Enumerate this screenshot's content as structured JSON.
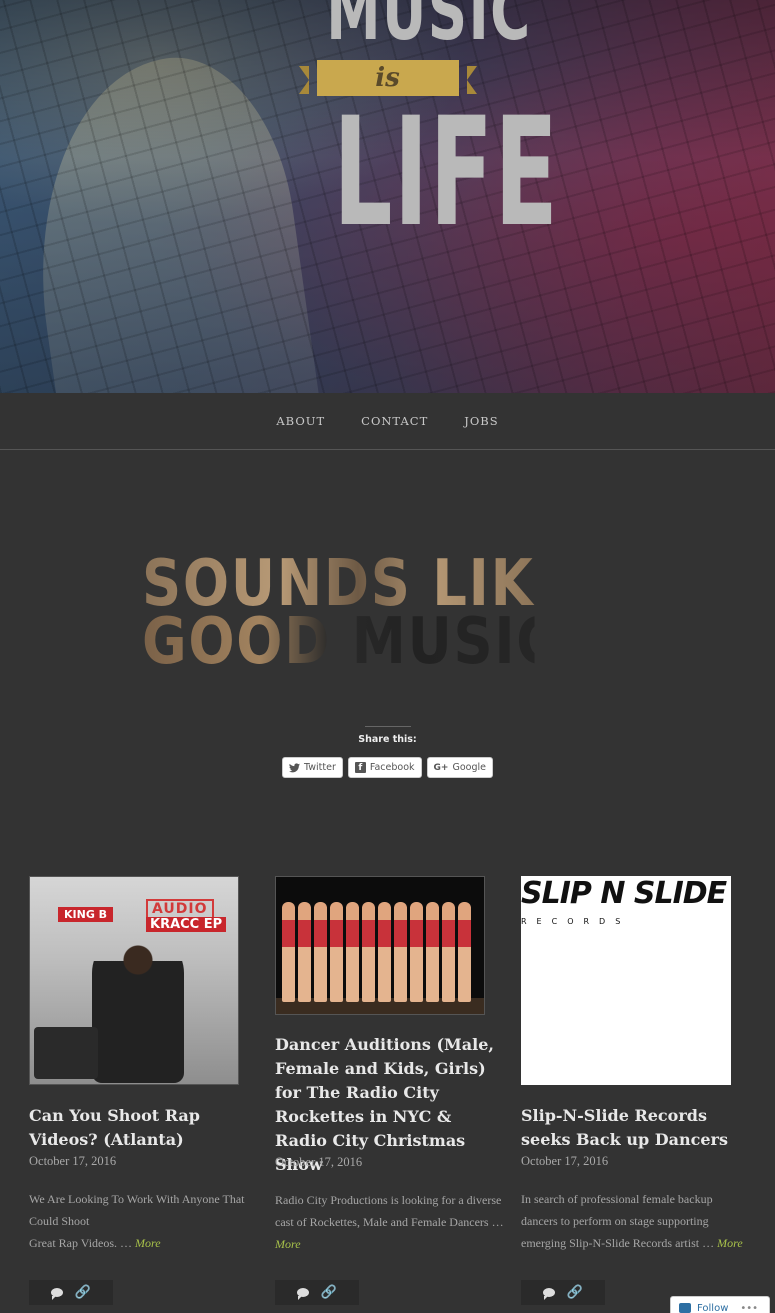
{
  "header": {
    "logo_top": "MUSIC",
    "logo_middle": "is",
    "logo_bottom": "LIFE"
  },
  "nav": {
    "items": [
      {
        "label": "ABOUT"
      },
      {
        "label": "CONTACT"
      },
      {
        "label": "JOBS"
      }
    ]
  },
  "featured": {
    "line1": "SOUNDS LIKE",
    "line2": "GOOD MUSIC."
  },
  "share": {
    "title": "Share this:",
    "buttons": [
      {
        "label": "Twitter",
        "icon": "twitter-icon"
      },
      {
        "label": "Facebook",
        "icon": "facebook-icon"
      },
      {
        "label": "Google",
        "icon": "google-plus-icon"
      }
    ]
  },
  "posts": [
    {
      "title": "Can You Shoot Rap Videos? (Atlanta)",
      "date": "October 17, 2016",
      "excerpt_line1": "We Are Looking To Work With Anyone That Could Shoot",
      "excerpt_line2": "Great Rap Videos. …",
      "more": "More",
      "thumb": {
        "tag": "KING B",
        "line1": "AUDIO",
        "line2": "KRACC EP"
      }
    },
    {
      "title": "Dancer Auditions (Male, Female and Kids, Girls) for The Radio City Rockettes in NYC & Radio City Christmas Show",
      "date": "October 17, 2016",
      "excerpt": "Radio City Productions is looking for a diverse cast of Rockettes, Male and Female Dancers …",
      "more": "More"
    },
    {
      "title": "Slip-N-Slide Records seeks Back up Dancers",
      "date": "October 17, 2016",
      "excerpt": "In search of professional female backup dancers to perform on stage supporting emerging Slip-N-Slide Records artist …",
      "more": "More",
      "thumb": {
        "brand": "SLIP N SLIDE",
        "sub": "RECORDS"
      }
    }
  ],
  "follow": {
    "label": "Follow",
    "dots": "•••"
  },
  "colors": {
    "background": "#333333",
    "accent_more": "#a8c24a",
    "title": "#e8e8e8"
  }
}
